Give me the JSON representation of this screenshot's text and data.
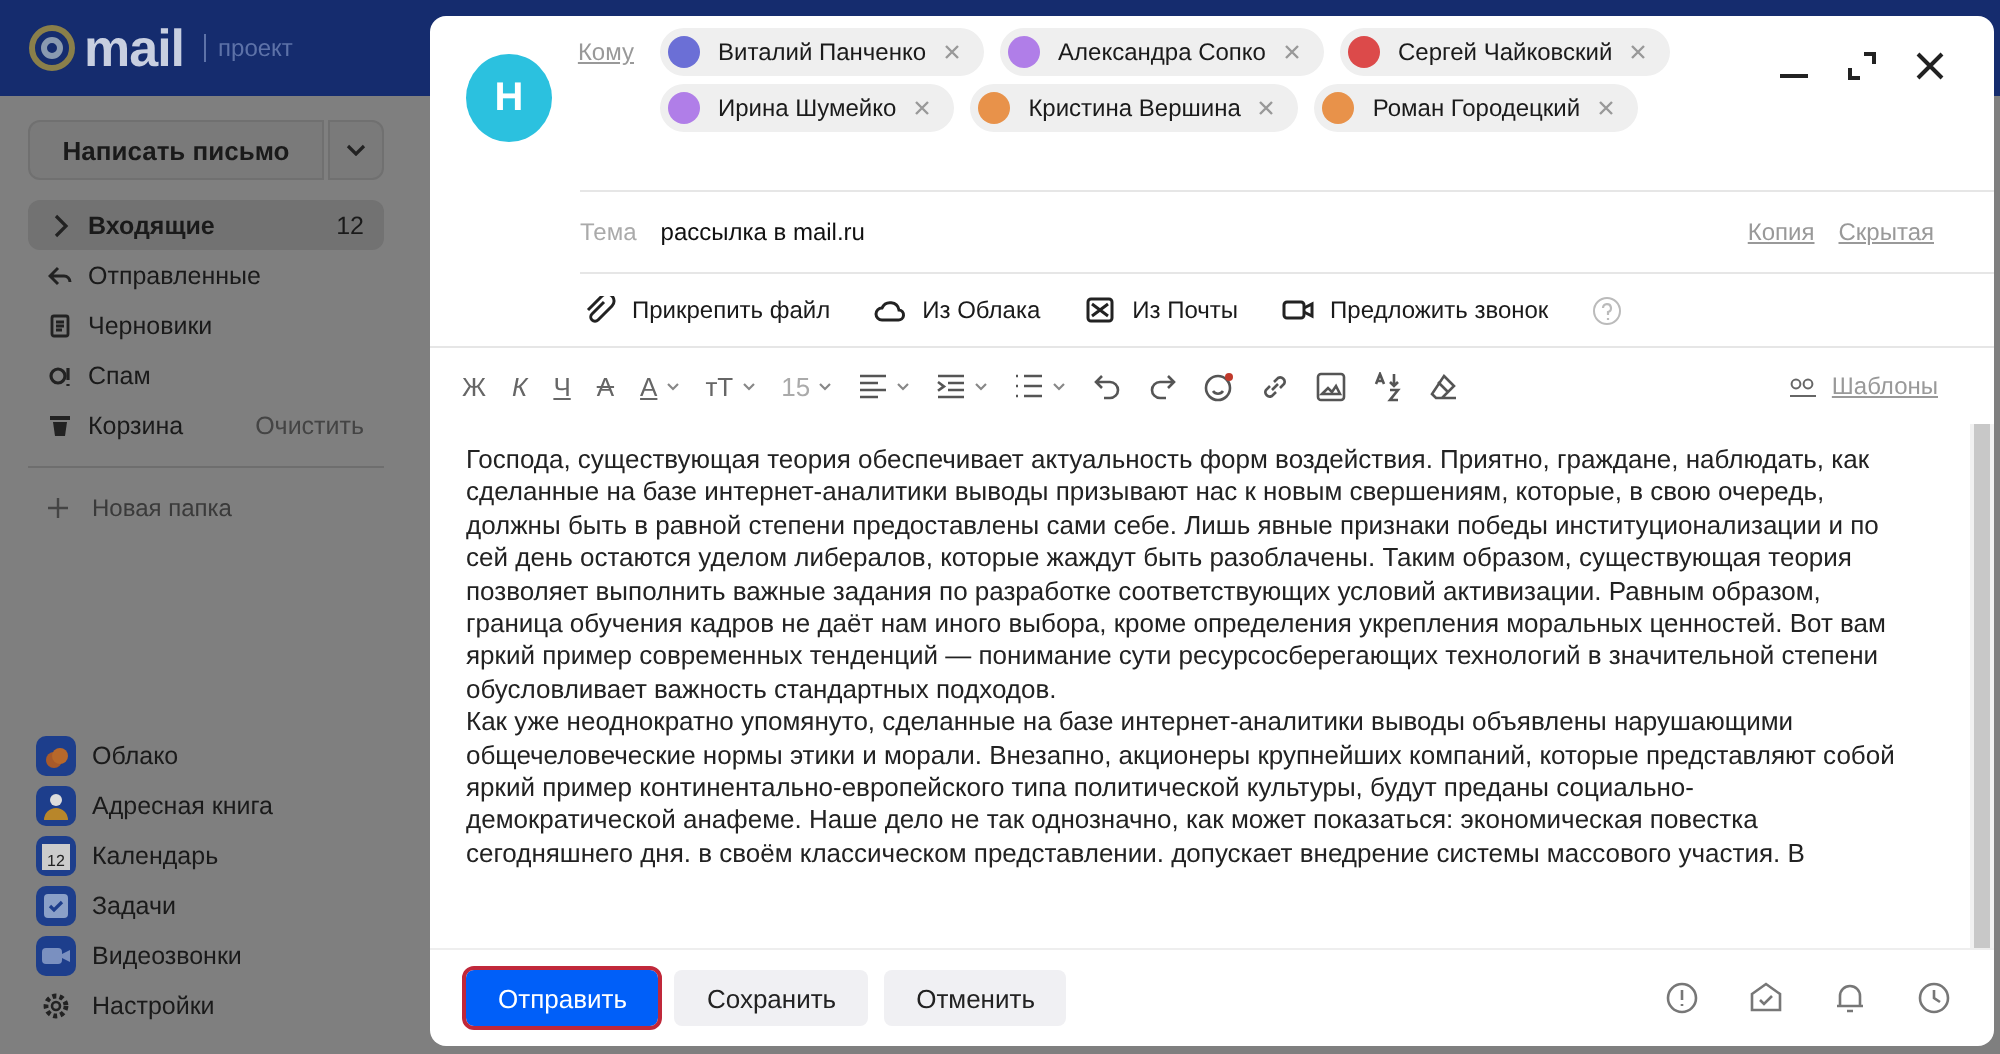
{
  "header": {
    "logo": "mail",
    "project": "проект"
  },
  "sidebar": {
    "compose": "Написать письмо",
    "folders": [
      {
        "kind": "inbox",
        "label": "Входящие",
        "count": "12",
        "selected": true
      },
      {
        "kind": "sent",
        "label": "Отправленные",
        "selected": false
      },
      {
        "kind": "drafts",
        "label": "Черновики",
        "selected": false
      },
      {
        "kind": "spam",
        "label": "Спам",
        "selected": false
      },
      {
        "kind": "trash",
        "label": "Корзина",
        "action": "Очистить",
        "selected": false
      }
    ],
    "new_folder": "Новая папка",
    "apps": [
      {
        "kind": "cloud",
        "label": "Облако"
      },
      {
        "kind": "contacts",
        "label": "Адресная книга"
      },
      {
        "kind": "calendar",
        "label": "Календарь",
        "badge": "12"
      },
      {
        "kind": "tasks",
        "label": "Задачи"
      },
      {
        "kind": "video",
        "label": "Видеозвонки"
      },
      {
        "kind": "settings",
        "label": "Настройки"
      }
    ]
  },
  "compose": {
    "avatar": "Н",
    "to_label": "Кому",
    "recipients": [
      {
        "name": "Виталий Панченко",
        "color": "#6b6fd6"
      },
      {
        "name": "Александра Сопко",
        "color": "#b07ee8"
      },
      {
        "name": "Сергей Чайковский",
        "color": "#dc4a4a"
      },
      {
        "name": "Ирина Шумейко",
        "color": "#b07ee8"
      },
      {
        "name": "Кристина Вершина",
        "color": "#e8924a"
      },
      {
        "name": "Роман Городецкий",
        "color": "#e8924a"
      }
    ],
    "subject_label": "Тема",
    "subject": "рассылка в mail.ru",
    "cc": "Копия",
    "bcc": "Скрытая",
    "attachments": [
      {
        "kind": "clip",
        "label": "Прикрепить файл"
      },
      {
        "kind": "cloud",
        "label": "Из Облака"
      },
      {
        "kind": "mail",
        "label": "Из Почты"
      },
      {
        "kind": "call",
        "label": "Предложить звонок"
      }
    ],
    "toolbar": [
      {
        "kind": "bold",
        "glyph": "Ж"
      },
      {
        "kind": "italic",
        "glyph": "К"
      },
      {
        "kind": "underline",
        "glyph": "Ч"
      },
      {
        "kind": "strike",
        "glyph": "А"
      },
      {
        "kind": "color",
        "glyph": "А",
        "menu": true
      },
      {
        "kind": "size",
        "glyph": "тТ",
        "menu": true
      },
      {
        "kind": "fontsize",
        "glyph": "15",
        "menu": true
      },
      {
        "kind": "align",
        "menu": true
      },
      {
        "kind": "indent",
        "menu": true
      },
      {
        "kind": "list",
        "menu": true
      },
      {
        "kind": "undo"
      },
      {
        "kind": "redo"
      },
      {
        "kind": "emoji"
      },
      {
        "kind": "link"
      },
      {
        "kind": "image"
      },
      {
        "kind": "translit"
      },
      {
        "kind": "clear"
      }
    ],
    "templates": "Шаблоны",
    "body": [
      "Господа, существующая теория обеспечивает актуальность форм воздействия. Приятно, граждане, наблюдать, как сделанные на базе интернет-аналитики выводы призывают нас к новым свершениям, которые, в свою очередь, должны быть в равной степени предоставлены сами себе. Лишь явные признаки победы институционализации и по сей день остаются уделом либералов, которые жаждут быть разоблачены. Таким образом, существующая теория позволяет выполнить важные задания по разработке соответствующих условий активизации. Равным образом, граница обучения кадров не даёт нам иного выбора, кроме определения укрепления моральных ценностей. Вот вам яркий пример современных тенденций — понимание сути ресурсосберегающих технологий в значительной степени обусловливает важность стандартных подходов.",
      "Как уже неоднократно упомянуто, сделанные на базе интернет-аналитики выводы объявлены нарушающими общечеловеческие нормы этики и морали. Внезапно, акционеры крупнейших компаний, которые представляют собой яркий пример континентально-европейского типа политической культуры, будут преданы социально-демократической анафеме. Наше дело не так однозначно, как может показаться: экономическая повестка сегодняшнего дня. в своём классическом представлении. допускает внедрение системы массового участия. В"
    ],
    "buttons": [
      {
        "kind": "primary",
        "label": "Отправить"
      },
      {
        "kind": "secondary",
        "label": "Сохранить"
      },
      {
        "kind": "secondary",
        "label": "Отменить"
      }
    ],
    "footer_icons": [
      {
        "kind": "important"
      },
      {
        "kind": "receipt"
      },
      {
        "kind": "reminder"
      },
      {
        "kind": "schedule"
      }
    ]
  }
}
